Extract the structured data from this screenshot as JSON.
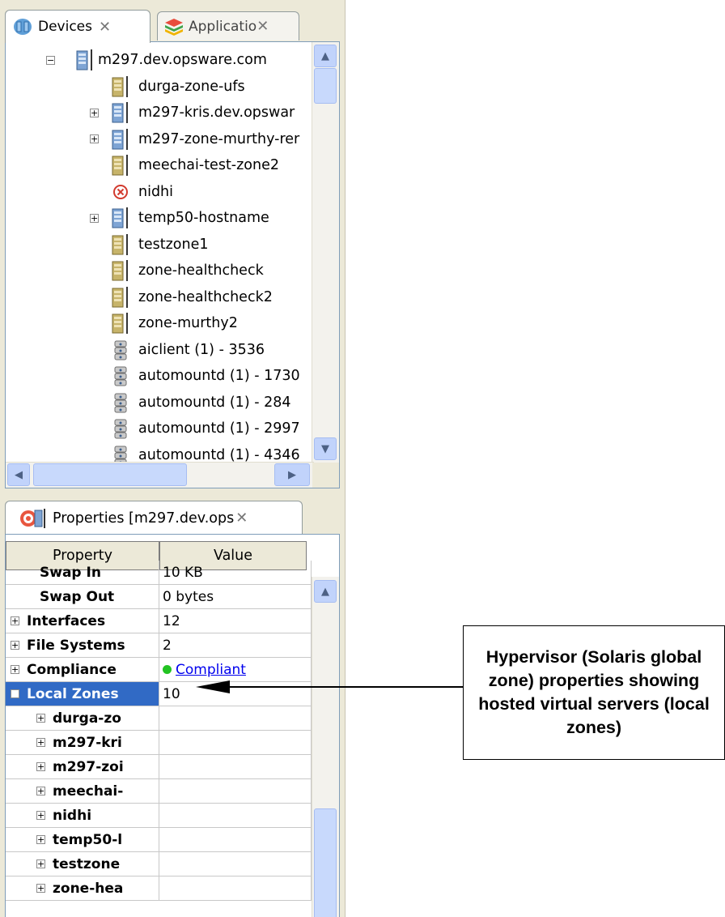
{
  "tabs": [
    {
      "label": "Devices",
      "active": true
    },
    {
      "label": "Applicatio",
      "active": false
    }
  ],
  "tree": {
    "root": {
      "label": "m297.dev.opsware.com",
      "expanded": true
    },
    "children": [
      {
        "label": "durga-zone-ufs",
        "icon": "zone-server-icon",
        "expandable": false
      },
      {
        "label": "m297-kris.dev.opswar",
        "icon": "server-icon",
        "expandable": true
      },
      {
        "label": "m297-zone-murthy-rer",
        "icon": "server-icon",
        "expandable": true
      },
      {
        "label": "meechai-test-zone2",
        "icon": "zone-server-icon",
        "expandable": false
      },
      {
        "label": "nidhi",
        "icon": "error-icon",
        "expandable": false
      },
      {
        "label": "temp50-hostname",
        "icon": "server-icon",
        "expandable": true
      },
      {
        "label": "testzone1",
        "icon": "zone-server-icon",
        "expandable": false
      },
      {
        "label": "zone-healthcheck",
        "icon": "zone-server-icon",
        "expandable": false
      },
      {
        "label": "zone-healthcheck2",
        "icon": "zone-server-icon",
        "expandable": false
      },
      {
        "label": "zone-murthy2",
        "icon": "zone-server-icon",
        "expandable": false
      },
      {
        "label": "aiclient (1) - 3536",
        "icon": "process-icon",
        "expandable": false
      },
      {
        "label": "automountd (1) - 1730",
        "icon": "process-icon",
        "expandable": false
      },
      {
        "label": "automountd (1) - 284",
        "icon": "process-icon",
        "expandable": false
      },
      {
        "label": "automountd (1) - 2997",
        "icon": "process-icon",
        "expandable": false
      },
      {
        "label": "automountd (1) - 4346",
        "icon": "process-icon",
        "expandable": false
      }
    ]
  },
  "properties": {
    "tab_label": "Properties [m297.dev.ops",
    "columns": {
      "property": "Property",
      "value": "Value"
    },
    "rows": [
      {
        "name": "Swap In",
        "value": "10 KB",
        "expandable": false
      },
      {
        "name": "Swap Out",
        "value": "0 bytes",
        "expandable": false
      },
      {
        "name": "Interfaces",
        "value": "12",
        "expandable": true
      },
      {
        "name": "File Systems",
        "value": "2",
        "expandable": true
      },
      {
        "name": "Compliance",
        "value": "Compliant",
        "expandable": true
      },
      {
        "name": "Local Zones",
        "value": "10",
        "expandable": true,
        "expanded": true,
        "selected": true
      },
      {
        "name": "durga-zo",
        "value": "",
        "expandable": true,
        "child": true
      },
      {
        "name": "m297-kri",
        "value": "",
        "expandable": true,
        "child": true
      },
      {
        "name": "m297-zoi",
        "value": "",
        "expandable": true,
        "child": true
      },
      {
        "name": "meechai-",
        "value": "",
        "expandable": true,
        "child": true
      },
      {
        "name": "nidhi",
        "value": "",
        "expandable": true,
        "child": true
      },
      {
        "name": "temp50-l",
        "value": "",
        "expandable": true,
        "child": true
      },
      {
        "name": "testzone",
        "value": "",
        "expandable": true,
        "child": true
      },
      {
        "name": "zone-hea",
        "value": "",
        "expandable": true,
        "child": true
      }
    ]
  },
  "callout": {
    "text": "Hypervisor (Solaris global zone) properties showing hosted virtual servers (local zones)"
  },
  "colors": {
    "selection": "#316ac5",
    "compliant": "#22c322",
    "panel_bg": "#ece9d8",
    "link": "#0000ee"
  }
}
